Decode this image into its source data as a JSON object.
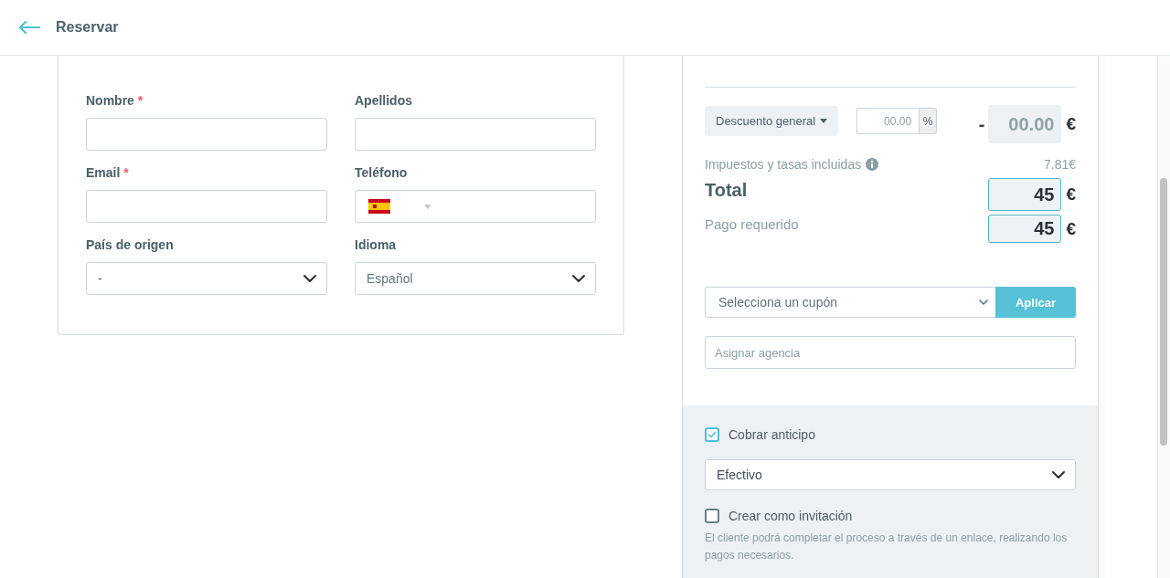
{
  "header": {
    "title": "Reservar"
  },
  "guest_form": {
    "fields": [
      {
        "label": "Nombre",
        "required_mark": "*",
        "kind": "text"
      },
      {
        "label": "Apellidos",
        "kind": "text"
      },
      {
        "label": "Email",
        "required_mark": "*",
        "kind": "text"
      },
      {
        "label": "Teléfono",
        "kind": "phone"
      },
      {
        "label": "País de origen",
        "kind": "select",
        "value": "-"
      },
      {
        "label": "Idioma",
        "kind": "select",
        "value": "Español"
      }
    ]
  },
  "summary": {
    "discount": {
      "type_label": "Descuento general",
      "percent_placeholder": "00.00",
      "percent_unit": "%",
      "sign": "-",
      "amount": "00.00",
      "currency": "€"
    },
    "taxes": {
      "label": "Impuestos y tasas incluidas",
      "value": "7.81€"
    },
    "total": {
      "label": "Total",
      "value": "45",
      "currency": "€"
    },
    "required_payment": {
      "label": "Pago requerido",
      "value": "45",
      "currency": "€"
    },
    "coupon": {
      "placeholder": "Selecciona un cupón",
      "button": "Aplicar"
    },
    "agency": {
      "placeholder": "Asignar agencia"
    }
  },
  "payment": {
    "collect_deposit": {
      "label": "Cobrar anticipo",
      "checked": true
    },
    "method": {
      "value": "Efectivo"
    },
    "invitation": {
      "label": "Crear como invitación",
      "checked": false,
      "help": "El cliente podrá completar el proceso a través de un enlace, realizando los pagos necesarios."
    }
  }
}
